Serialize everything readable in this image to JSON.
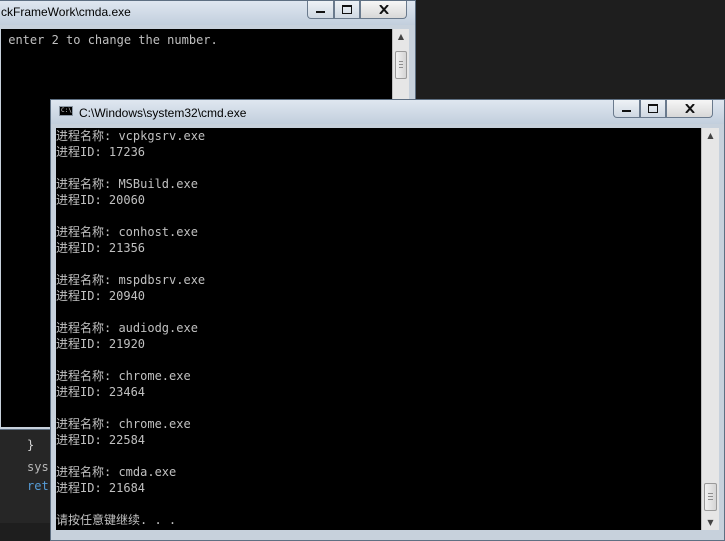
{
  "editor": {
    "lines": [
      "}",
      "sys",
      "ret"
    ]
  },
  "back_window": {
    "title": "ckFrameWork\\cmda.exe",
    "console_lines": [
      " enter 2 to change the number."
    ]
  },
  "front_window": {
    "title": "C:\\Windows\\system32\\cmd.exe",
    "icon_text": "C:\\",
    "console_lines": [
      "进程名称: vcpkgsrv.exe",
      "进程ID: 17236",
      "",
      "进程名称: MSBuild.exe",
      "进程ID: 20060",
      "",
      "进程名称: conhost.exe",
      "进程ID: 21356",
      "",
      "进程名称: mspdbsrv.exe",
      "进程ID: 20940",
      "",
      "进程名称: audiodg.exe",
      "进程ID: 21920",
      "",
      "进程名称: chrome.exe",
      "进程ID: 23464",
      "",
      "进程名称: chrome.exe",
      "进程ID: 22584",
      "",
      "进程名称: cmda.exe",
      "进程ID: 21684",
      "",
      "请按任意键继续. . ."
    ]
  },
  "controls": {
    "minimize": "minimize-icon",
    "maximize": "maximize-icon",
    "close": "close-icon"
  },
  "colors": {
    "console_bg": "#000000",
    "console_text": "#c0c0c0",
    "titlebar": "#c7d1dc",
    "editor_bg": "#1e1e1e"
  }
}
